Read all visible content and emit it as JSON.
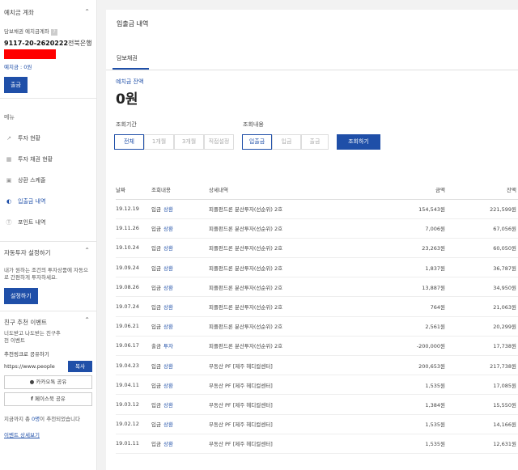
{
  "sidebar": {
    "deposit_section": {
      "title": "예치금 계좌",
      "account_label": "담보채권 예치금계좌",
      "account_number": "9117-20-2620222",
      "bank": "전북은행",
      "balance_link": "예치금 : 0원",
      "withdraw_button": "출금"
    },
    "menu_title": "메뉴",
    "menu_items": [
      {
        "label": "투자 현황",
        "icon": "chart-line-icon"
      },
      {
        "label": "투자 채권 현황",
        "icon": "bar-chart-icon"
      },
      {
        "label": "상환 스케줄",
        "icon": "calendar-icon"
      },
      {
        "label": "입출금 내역",
        "icon": "transfer-icon"
      },
      {
        "label": "포인트 내역",
        "icon": "point-icon"
      }
    ],
    "auto_invest": {
      "title": "자동투자 설정하기",
      "desc": "내가 원하는 조건의 투자상품에 자동으로 간편하게 투자하세요.",
      "button": "설정하기"
    },
    "referral": {
      "title": "친구 추천 이벤트",
      "desc": "너도받고 나도받는 친구추천 이벤트",
      "share_label": "추천링크로 공유하기",
      "url_value": "https://www.people",
      "copy_button": "복사",
      "kakao_button": "카카오톡 공유",
      "facebook_button": "페이스북 공유",
      "count_text_pre": "지금까지 총 ",
      "count_value": "0명",
      "count_text_post": "이 추천되었습니다",
      "detail_link": "이벤트 상세보기"
    }
  },
  "main": {
    "title": "입출금 내역",
    "tab": "담보채권",
    "balance_label": "예치금 잔액",
    "balance_value": "0원",
    "period_label": "조회기간",
    "period_options": [
      "전체",
      "1개월",
      "3개월",
      "직접설정"
    ],
    "period_selected": "전체",
    "type_label": "조회내용",
    "type_options": [
      "입출금",
      "입금",
      "출금"
    ],
    "type_selected": "입출금",
    "search_button": "조회하기",
    "table": {
      "headers": [
        "날짜",
        "조회내용",
        "상세내역",
        "금액",
        "잔액"
      ],
      "rows": [
        {
          "date": "19.12.19",
          "kind": "입금",
          "sub": "상환",
          "detail": "피플펀드론 분산투자(선순위) 2호",
          "amount": "154,543원",
          "balance": "221,599원"
        },
        {
          "date": "19.11.26",
          "kind": "입금",
          "sub": "상환",
          "detail": "피플펀드론 분산투자(선순위) 2호",
          "amount": "7,006원",
          "balance": "67,056원"
        },
        {
          "date": "19.10.24",
          "kind": "입금",
          "sub": "상환",
          "detail": "피플펀드론 분산투자(선순위) 2호",
          "amount": "23,263원",
          "balance": "60,050원"
        },
        {
          "date": "19.09.24",
          "kind": "입금",
          "sub": "상환",
          "detail": "피플펀드론 분산투자(선순위) 2호",
          "amount": "1,837원",
          "balance": "36,787원"
        },
        {
          "date": "19.08.26",
          "kind": "입금",
          "sub": "상환",
          "detail": "피플펀드론 분산투자(선순위) 2호",
          "amount": "13,887원",
          "balance": "34,950원"
        },
        {
          "date": "19.07.24",
          "kind": "입금",
          "sub": "상환",
          "detail": "피플펀드론 분산투자(선순위) 2호",
          "amount": "764원",
          "balance": "21,063원"
        },
        {
          "date": "19.06.21",
          "kind": "입금",
          "sub": "상환",
          "detail": "피플펀드론 분산투자(선순위) 2호",
          "amount": "2,561원",
          "balance": "20,299원"
        },
        {
          "date": "19.06.17",
          "kind": "출금",
          "sub": "투자",
          "detail": "피플펀드론 분산투자(선순위) 2호",
          "amount": "-200,000원",
          "balance": "17,738원"
        },
        {
          "date": "19.04.23",
          "kind": "입금",
          "sub": "상환",
          "detail": "부동산 PF [제주 헤디컬센터]",
          "amount": "200,653원",
          "balance": "217,738원"
        },
        {
          "date": "19.04.11",
          "kind": "입금",
          "sub": "상환",
          "detail": "부동산 PF [제주 헤디컬센터]",
          "amount": "1,535원",
          "balance": "17,085원"
        },
        {
          "date": "19.03.12",
          "kind": "입금",
          "sub": "상환",
          "detail": "부동산 PF [제주 헤디컬센터]",
          "amount": "1,384원",
          "balance": "15,550원"
        },
        {
          "date": "19.02.12",
          "kind": "입금",
          "sub": "상환",
          "detail": "부동산 PF [제주 헤디컬센터]",
          "amount": "1,535원",
          "balance": "14,166원"
        },
        {
          "date": "19.01.11",
          "kind": "입금",
          "sub": "상환",
          "detail": "부동산 PF [제주 헤디컬센터]",
          "amount": "1,535원",
          "balance": "12,631원"
        }
      ]
    }
  },
  "colors": {
    "accent": "#1f4fa8",
    "redaction": "#ff0000"
  }
}
